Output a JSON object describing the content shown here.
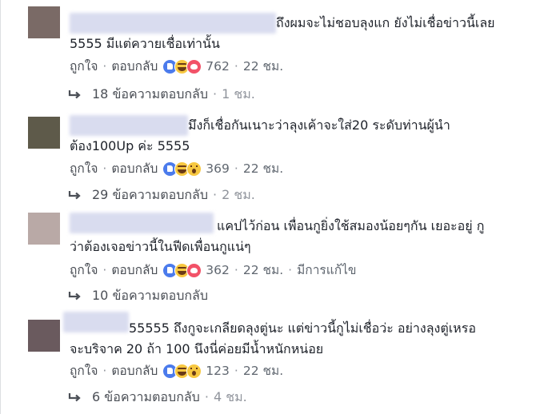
{
  "labels": {
    "like": "ถูกใจ",
    "reply": "ตอบกลับ",
    "dot": "·"
  },
  "colors": {
    "name_blur": "#d9dcef",
    "like_reaction": "#4b7bec",
    "haha_reaction": "#f7c841",
    "love_reaction": "#f25268",
    "link_gray": "#4b4f56"
  },
  "comments": [
    {
      "avatar_color": "#7a6a66",
      "text_line1": "ถึงผมจะไม่ชอบลุงแก ยังไม่เชื่อข่าวนี้เลย",
      "text_line2": "5555 มีแต่ควายเชื่อเท่านั้น",
      "reactions": [
        "like-icon",
        "haha-icon",
        "love-icon"
      ],
      "reaction_count": "762",
      "time": "22 ชม.",
      "edited": "",
      "replies_label": "18 ข้อความตอบกลับ",
      "replies_time": "1 ชม."
    },
    {
      "avatar_color": "#5e5a4a",
      "text_line1": "มึงก็เชื่อกันเนาะว่าลุงเค้าจะใส่20 ระดับท่านผู้นำ",
      "text_line2": "ต้อง100Up ค่ะ 5555",
      "reactions": [
        "like-icon",
        "haha-icon",
        "wow-icon"
      ],
      "reaction_count": "369",
      "time": "22 ชม.",
      "edited": "",
      "replies_label": "29 ข้อความตอบกลับ",
      "replies_time": "2 ชม."
    },
    {
      "avatar_color": "#b9a9a6",
      "text_line1": "แคปไว้ก่อน เพื่อนกูยิ่งใช้สมองน้อยๆกัน เยอะอยู่ กู",
      "text_line2": "ว่าต้องเจอข่าวนี้ในฟีดเพื่อนกูแน่ๆ",
      "reactions": [
        "like-icon",
        "haha-icon",
        "love-icon"
      ],
      "reaction_count": "362",
      "time": "22 ชม.",
      "edited": "มีการแก้ไข",
      "replies_label": "10 ข้อความตอบกลับ",
      "replies_time": ""
    },
    {
      "avatar_color": "#6a5a5e",
      "text_line1": "55555 ถึงกูจะเกลียดลุงตู่นะ แต่ข่าวนี้กูไม่เชื่อว่ะ อย่างลุงตู่เหรอ",
      "text_line2": "จะบริจาค 20 ถ้า 100 นึงนี่ค่อยมีน้ำหนักหน่อย",
      "reactions": [
        "like-icon",
        "haha-icon",
        "wow-icon"
      ],
      "reaction_count": "123",
      "time": "22 ชม.",
      "edited": "",
      "replies_label": "6 ข้อความตอบกลับ",
      "replies_time": "4 ชม."
    }
  ]
}
